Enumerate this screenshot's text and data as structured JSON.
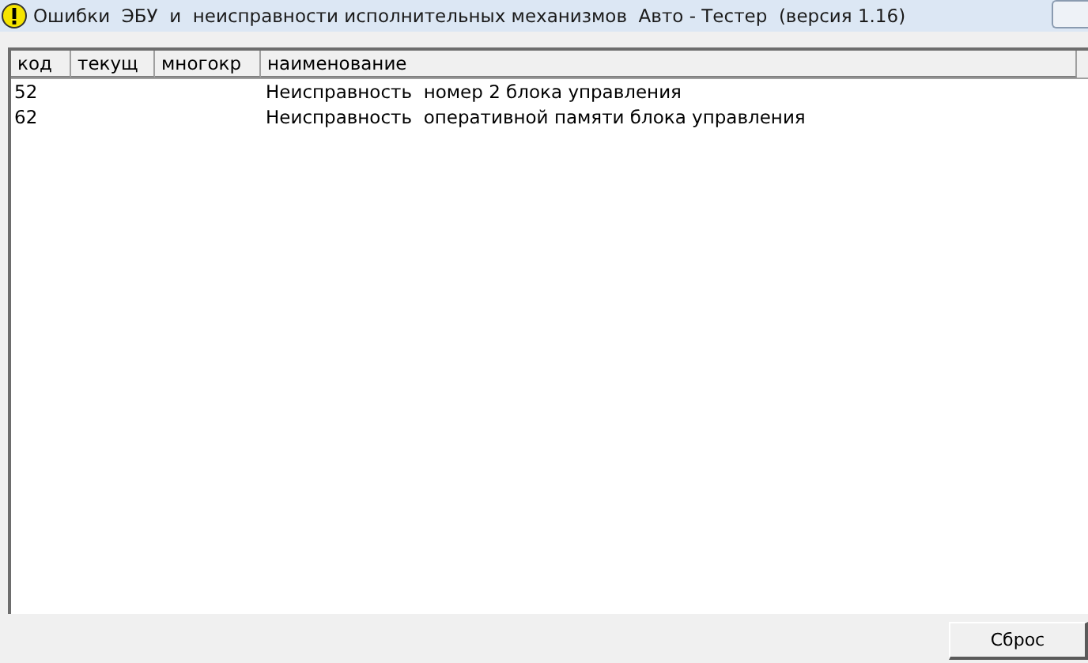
{
  "window": {
    "title": "Ошибки  ЭБУ  и  неисправности исполнительных механизмов  Авто - Тестер  (версия 1.16)"
  },
  "table": {
    "columns": [
      "код",
      "текущ",
      "многокр",
      "наименование"
    ],
    "rows": [
      {
        "cells": [
          "52",
          "",
          "",
          "Неисправность  номер 2 блока управления"
        ]
      },
      {
        "cells": [
          "62",
          "",
          "",
          "Неисправность  оперативной памяти блока управления"
        ]
      }
    ]
  },
  "buttons": [
    "Сброс"
  ]
}
